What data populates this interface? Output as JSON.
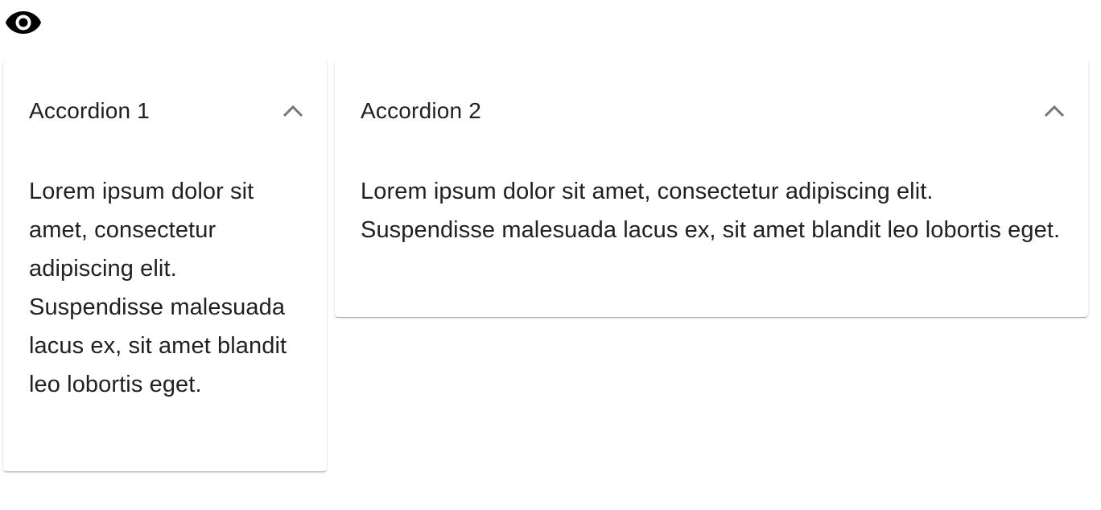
{
  "visibility_toggle": {
    "icon": "eye-icon"
  },
  "accordions": [
    {
      "title": "Accordion 1",
      "expanded": true,
      "icon": "chevron-up-icon",
      "body": "Lorem ipsum dolor sit amet, consectetur adipiscing elit. Suspendisse malesuada lacus ex, sit amet blandit leo lobortis eget."
    },
    {
      "title": "Accordion 2",
      "expanded": true,
      "icon": "chevron-up-icon",
      "body": "Lorem ipsum dolor sit amet, consectetur adipiscing elit. Suspendisse malesuada lacus ex, sit amet blandit leo lobortis eget."
    }
  ],
  "colors": {
    "text": "#212121",
    "icon": "#000000",
    "chevron": "#757575",
    "surface": "#ffffff"
  }
}
